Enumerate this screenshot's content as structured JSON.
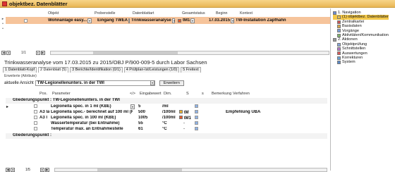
{
  "window": {
    "title": "objektbez. Datenblätter"
  },
  "top_grid": {
    "headers": [
      "Objekt",
      "Probenstelle",
      "Datenblattart",
      "Gesamtstatus",
      "Beginn",
      "Kontext"
    ],
    "row": {
      "objekt": "Wohnanlage easy...",
      "probenstelle": "Eingang TWEA",
      "datenblattart": "Trinkwasseranalyse",
      "status": "tM1",
      "beginn": "17.03.2015",
      "kontext": "TW-Installation Zapfhahn"
    },
    "status_color": "#e35a2a"
  },
  "top_nav": {
    "page": "1/1"
  },
  "header": {
    "title": "Trinkwasseranalyse vom 17.03.2015 zu 2015/OBJ P/900-009-5 durch Labor Sachsen"
  },
  "tabs": [
    {
      "label": "1 Datenblatt-Kopf"
    },
    {
      "label": "2 Datenblatt (5)"
    },
    {
      "label": "3 Berichte/Identifikation (0/1)"
    },
    {
      "label": "4 Prüfplan-Ist/Leistungen (1/0)"
    },
    {
      "label": "5 Freitext"
    }
  ],
  "view": {
    "extended_label": "Erweiterte (Attribute)",
    "label": "aktuelle Ansicht",
    "value": "TW-Legionellenunters. in der TWI",
    "button": "Erweitern"
  },
  "grid": {
    "headers": [
      "Pos.",
      "Parameter",
      "</>",
      "Eingabewert",
      "Dim.",
      "S",
      "s",
      "Bemerkung",
      "Verfahren"
    ],
    "group1": "Gliederungspunkt : TW-Legionellenunters. in der TWI",
    "rows": [
      {
        "pos": "",
        "param": "Legionella spec. in 1 ml (KBE)",
        "lt": "",
        "value": "5",
        "dim": "/ml",
        "s": "",
        "bem": "",
        "verf": "",
        "s_color": ""
      },
      {
        "pos": "A3 la",
        "param": "Legionella spec.- berechnet auf 100 ml (KBE)",
        "lt": "",
        "value": "500",
        "dim": "/100ml",
        "s": "tM",
        "bem": "",
        "verf": "Empfehlung UBA",
        "s_color": "#e8b232"
      },
      {
        "pos": "A3 l",
        "param": "Legionella spec. in 100 ml (KBE)",
        "lt": "",
        "value": "1005",
        "dim": "/100ml",
        "s": "tM1",
        "bem": "",
        "verf": "",
        "s_color": "#e35a2a"
      },
      {
        "pos": "",
        "param": "Wassertemperatur (bei Entnahme)",
        "lt": "",
        "value": "55",
        "dim": "°C",
        "s": "-",
        "bem": "",
        "verf": "",
        "s_color": ""
      },
      {
        "pos": "",
        "param": "Temperatur max. an Entnahmestelle",
        "lt": "",
        "value": "61",
        "dim": "°C",
        "s": "-",
        "bem": "",
        "verf": "",
        "s_color": ""
      }
    ],
    "group2": "Gliederungspunkt :",
    "page": "1/5"
  },
  "nav": {
    "items": [
      {
        "label": "1. Navigation",
        "level": 0
      },
      {
        "label": "(1) objektbez. Datenblätter",
        "level": 1,
        "selected": true
      },
      {
        "label": "Zentralkartei",
        "level": 1
      },
      {
        "label": "Basisdaten",
        "level": 1
      },
      {
        "label": "Vorgänge",
        "level": 1
      },
      {
        "label": "Aktivitäten/Kommunikation",
        "level": 1
      },
      {
        "label": "2. Aktionen",
        "level": 0
      },
      {
        "label": "Objektprüfung",
        "level": 1
      },
      {
        "label": "Schnittstellen",
        "level": 1
      },
      {
        "label": "Auswertungen",
        "level": 1
      },
      {
        "label": "Korrekturen",
        "level": 1
      },
      {
        "label": "System",
        "level": 1
      }
    ]
  }
}
